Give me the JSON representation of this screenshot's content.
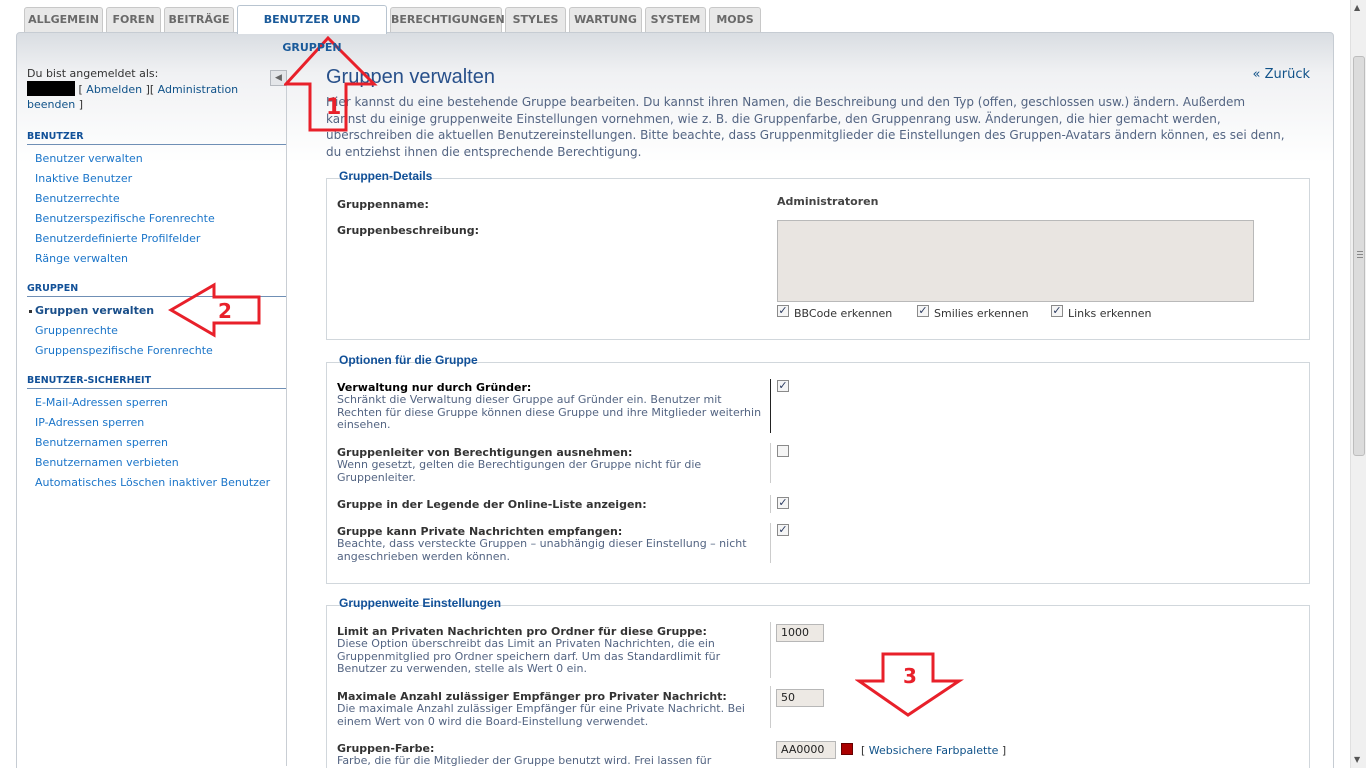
{
  "tabs": [
    {
      "label": "Allgemein",
      "active": false
    },
    {
      "label": "Foren",
      "active": false
    },
    {
      "label": "Beiträge",
      "active": false
    },
    {
      "label": "Benutzer und Gruppen",
      "active": true
    },
    {
      "label": "Berechtigungen",
      "active": false
    },
    {
      "label": "Styles",
      "active": false
    },
    {
      "label": "Wartung",
      "active": false
    },
    {
      "label": "System",
      "active": false
    },
    {
      "label": "Mods",
      "active": false
    }
  ],
  "sidebar": {
    "login_prefix": "Du bist angemeldet als:",
    "logout": "Abmelden",
    "admin_end": "Administration beenden",
    "sections": [
      {
        "title": "BENUTZER",
        "items": [
          {
            "label": "Benutzer verwalten"
          },
          {
            "label": "Inaktive Benutzer"
          },
          {
            "label": "Benutzerrechte"
          },
          {
            "label": "Benutzerspezifische Forenrechte"
          },
          {
            "label": "Benutzerdefinierte Profilfelder"
          },
          {
            "label": "Ränge verwalten"
          }
        ]
      },
      {
        "title": "GRUPPEN",
        "items": [
          {
            "label": "Gruppen verwalten",
            "active": true
          },
          {
            "label": "Gruppenrechte"
          },
          {
            "label": "Gruppenspezifische Forenrechte"
          }
        ]
      },
      {
        "title": "BENUTZER-SICHERHEIT",
        "items": [
          {
            "label": "E-Mail-Adressen sperren"
          },
          {
            "label": "IP-Adressen sperren"
          },
          {
            "label": "Benutzernamen sperren"
          },
          {
            "label": "Benutzernamen verbieten"
          },
          {
            "label": "Automatisches Löschen inaktiver Benutzer"
          }
        ]
      }
    ],
    "collapse_icon": "triangle-left-icon"
  },
  "main": {
    "title": "Gruppen verwalten",
    "back": "« Zurück",
    "intro": "Hier kannst du eine bestehende Gruppe bearbeiten. Du kannst ihren Namen, die Beschreibung und den Typ (offen, geschlossen usw.) ändern. Außerdem kannst du einige gruppenweite Einstellungen vornehmen, wie z. B. die Gruppenfarbe, den Gruppenrang usw. Änderungen, die hier gemacht werden, überschreiben die aktuellen Benutzereinstellungen. Bitte beachte, dass Gruppenmitglieder die Einstellungen des Gruppen-Avatars ändern können, es sei denn, du entziehst ihnen die entsprechende Berechtigung."
  },
  "details": {
    "legend": "Gruppen-Details",
    "name_label": "Gruppenname:",
    "name_value": "Administratoren",
    "desc_label": "Gruppenbeschreibung:",
    "desc_value": "",
    "opt_bbcode": "BBCode erkennen",
    "opt_smilies": "Smilies erkennen",
    "opt_links": "Links erkennen"
  },
  "options": {
    "legend": "Optionen für die Gruppe",
    "founder_label": "Verwaltung nur durch Gründer:",
    "founder_desc": "Schränkt die Verwaltung dieser Gruppe auf Gründer ein. Benutzer mit Rechten für diese Gruppe können diese Gruppe und ihre Mitglieder weiterhin einsehen.",
    "leader_label": "Gruppenleiter von Berechtigungen ausnehmen:",
    "leader_desc": "Wenn gesetzt, gelten die Berechtigungen der Gruppe nicht für die Gruppenleiter.",
    "legend_label": "Gruppe in der Legende der Online-Liste anzeigen:",
    "pm_label": "Gruppe kann Private Nachrichten empfangen:",
    "pm_desc": "Beachte, dass versteckte Gruppen – unabhängig dieser Einstellung – nicht angeschrieben werden können."
  },
  "settings": {
    "legend": "Gruppenweite Einstellungen",
    "pm_limit_label": "Limit an Privaten Nachrichten pro Ordner für diese Gruppe:",
    "pm_limit_desc": "Diese Option überschreibt das Limit an Privaten Nachrichten, die ein Gruppenmitglied pro Ordner speichern darf. Um das Standardlimit für Benutzer zu verwenden, stelle als Wert 0 ein.",
    "pm_limit_value": "1000",
    "max_recip_label": "Maximale Anzahl zulässiger Empfänger pro Privater Nachricht:",
    "max_recip_desc": "Die maximale Anzahl zulässiger Empfänger für eine Private Nachricht. Bei einem Wert von 0 wird die Board-Einstellung verwendet.",
    "max_recip_value": "50",
    "color_label": "Gruppen-Farbe:",
    "color_desc": "Farbe, die für die Mitglieder der Gruppe benutzt wird. Frei lassen für",
    "color_value": "AA0000",
    "color_hex": "#AA0000",
    "palette_link": "Websichere Farbpalette"
  },
  "annotations": {
    "one": "1",
    "two": "2",
    "three": "3",
    "color": "#e8202a"
  }
}
